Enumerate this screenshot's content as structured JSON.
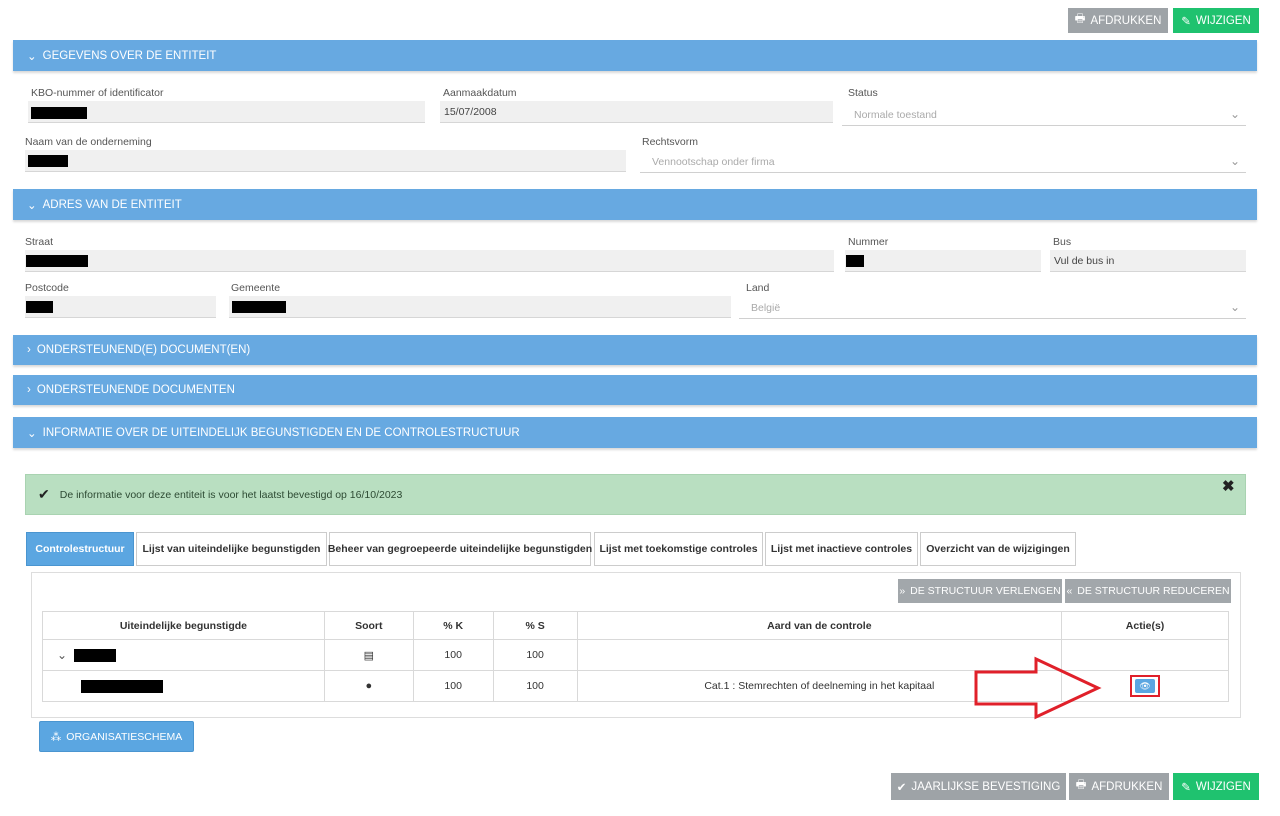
{
  "toolbar_top": {
    "print_label": "AFDRUKKEN",
    "edit_label": "WIJZIGEN"
  },
  "panels": {
    "entity": "GEGEVENS OVER DE ENTITEIT",
    "address": "ADRES VAN DE ENTITEIT",
    "supporting_doc": "ONDERSTEUNEND(E) DOCUMENT(EN)",
    "supporting_docs": "ONDERSTEUNENDE DOCUMENTEN",
    "ubo_info": "INFORMATIE OVER DE UITEINDELIJK BEGUNSTIGDEN EN DE CONTROLESTRUCTUUR"
  },
  "entity": {
    "kbo_label": "KBO-nummer of identificator",
    "date_label": "Aanmaakdatum",
    "date_value": "15/07/2008",
    "status_label": "Status",
    "status_value": "Normale toestand",
    "name_label": "Naam van de onderneming",
    "legal_form_label": "Rechtsvorm",
    "legal_form_value": "Vennootschap onder firma"
  },
  "address": {
    "street_label": "Straat",
    "number_label": "Nummer",
    "bus_label": "Bus",
    "bus_placeholder": "Vul de bus in",
    "postcode_label": "Postcode",
    "municipality_label": "Gemeente",
    "country_label": "Land",
    "country_value": "België"
  },
  "alert": {
    "text": "De informatie voor deze entiteit is voor het laatst bevestigd op 16/10/2023"
  },
  "tabs": [
    "Controlestructuur",
    "Lijst van uiteindelijke begunstigden",
    "Beheer van gegroepeerde uiteindelijke begunstigden",
    "Lijst met toekomstige controles",
    "Lijst met inactieve controles",
    "Overzicht van de wijzigingen"
  ],
  "structure": {
    "expand_label": "DE STRUCTUUR VERLENGEN",
    "reduce_label": "DE STRUCTUUR REDUCEREN"
  },
  "table": {
    "headers": [
      "Uiteindelijke begunstigde",
      "Soort",
      "% K",
      "% S",
      "Aard van de controle",
      "Actie(s)"
    ],
    "rows": [
      {
        "k": "100",
        "s": "100",
        "control": ""
      },
      {
        "k": "100",
        "s": "100",
        "control": "Cat.1 : Stemrechten of deelneming in het kapitaal"
      }
    ]
  },
  "org_chart_label": "ORGANISATIESCHEMA",
  "toolbar_bottom": {
    "confirm_label": "JAARLIJKSE BEVESTIGING",
    "print_label": "AFDRUKKEN",
    "edit_label": "WIJZIGEN"
  },
  "colors": {
    "panel": "#67a9e1",
    "green": "#1fc26f",
    "gray": "#9ea3a7",
    "highlight": "#e0202a"
  }
}
